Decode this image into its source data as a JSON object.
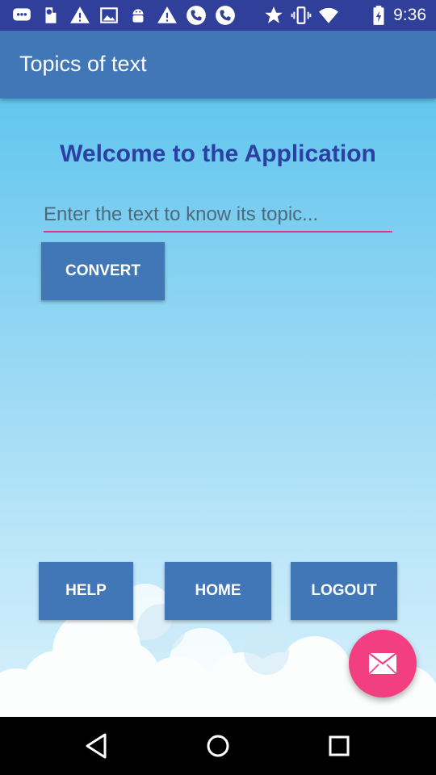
{
  "status_bar": {
    "time": "9:36",
    "icons": [
      "chat-icon",
      "voicemail-icon",
      "warning-icon",
      "image-icon",
      "android-icon",
      "warning-icon",
      "phone-icon",
      "phone-icon",
      "star-icon",
      "vibrate-icon",
      "wifi-icon",
      "battery-icon"
    ]
  },
  "app_bar": {
    "title": "Topics of text"
  },
  "main": {
    "welcome": "Welcome to the Application",
    "input_placeholder": "Enter the text to know its topic...",
    "input_value": "",
    "convert_label": "CONVERT"
  },
  "bottom_buttons": {
    "help_label": "HELP",
    "home_label": "HOME",
    "logout_label": "LOGOUT"
  },
  "fab": {
    "icon": "mail-icon"
  },
  "nav_bar": {
    "icons": [
      "back-icon",
      "home-icon",
      "recents-icon"
    ]
  },
  "colors": {
    "status_bar": "#2f3f9a",
    "primary": "#4277b7",
    "accent": "#f13f82",
    "welcome_text": "#2c3fa3",
    "input_underline": "#e0367a"
  }
}
